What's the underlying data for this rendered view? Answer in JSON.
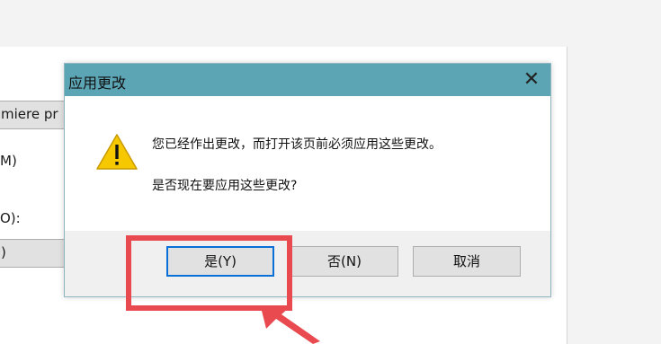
{
  "background": {
    "fragments": [
      "miere pr",
      "M)",
      "O):",
      ")"
    ]
  },
  "dialog": {
    "title": "应用更改",
    "close_glyph": "✕",
    "icon": "warning-icon",
    "message_line1": "您已经作出更改，而打开该页前必须应用这些更改。",
    "message_line2": "是否现在要应用这些更改?",
    "buttons": {
      "yes": "是(Y)",
      "no": "否(N)",
      "cancel": "取消"
    }
  },
  "annotation": {
    "highlight_color": "#e84a4f",
    "highlights": "yes-button"
  }
}
